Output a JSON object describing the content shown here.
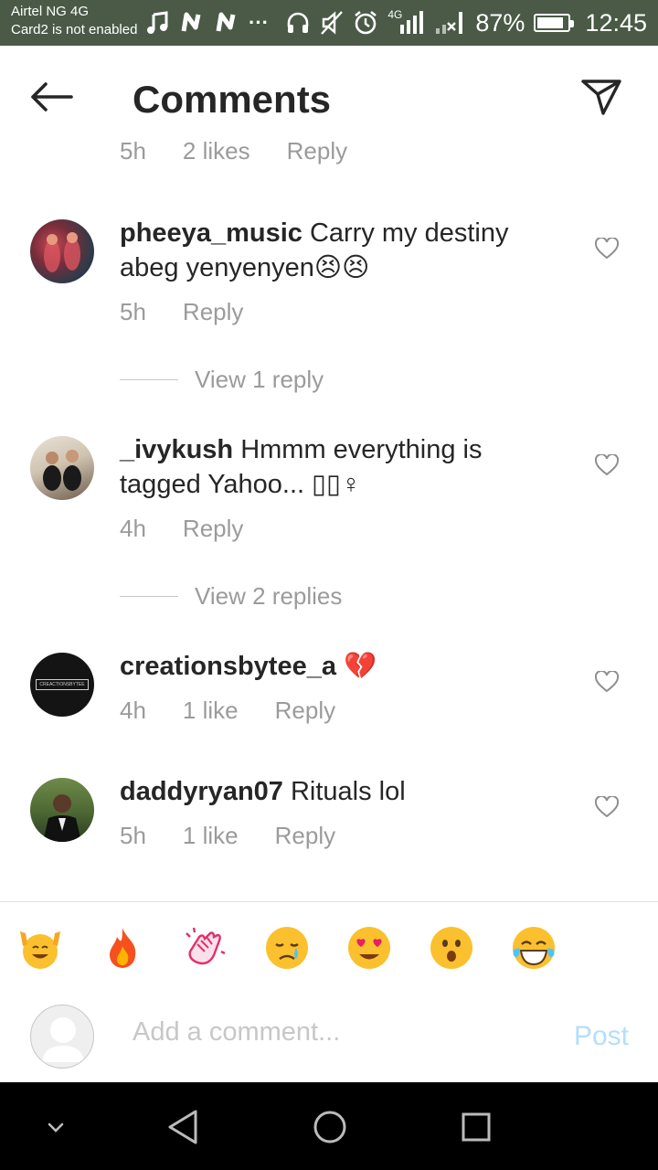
{
  "status_bar": {
    "carrier_line1": "Airtel NG 4G",
    "carrier_line2": "Card2 is not enabled",
    "notif_icons": [
      "music-note-icon",
      "n-app-icon",
      "n-app-icon",
      "more-dots-icon"
    ],
    "dots": "···",
    "network_type": "4G",
    "battery_percent": "87%",
    "battery_level": 0.87,
    "time": "12:45"
  },
  "header": {
    "title": "Comments"
  },
  "partial_comment": {
    "time": "5h",
    "likes": "2 likes",
    "reply": "Reply"
  },
  "comments": [
    {
      "username": "pheeya_music",
      "text": " Carry my destiny abeg yenyenyen",
      "emoji": "😣😣",
      "time": "5h",
      "likes": "",
      "reply": "Reply",
      "view_replies": "View 1 reply"
    },
    {
      "username": "_ivykush",
      "text": " Hmmm everything is tagged Yahoo... ",
      "emoji": "▯▯♀",
      "time": "4h",
      "likes": "",
      "reply": "Reply",
      "view_replies": "View 2 replies"
    },
    {
      "username": "creationsbytee_a",
      "text": " ",
      "emoji": "💔",
      "avatar_text": "CREACTIONSBYTEE",
      "time": "4h",
      "likes": "1 like",
      "reply": "Reply",
      "view_replies": ""
    },
    {
      "username": "daddyryan07",
      "text": " Rituals lol",
      "emoji": "",
      "time": "5h",
      "likes": "1 like",
      "reply": "Reply",
      "view_replies": ""
    }
  ],
  "emoji_bar": [
    "raising-hands-emoji",
    "fire-emoji",
    "clapping-hands-emoji",
    "crying-face-emoji",
    "heart-eyes-emoji",
    "surprised-face-emoji",
    "tears-of-joy-emoji"
  ],
  "composer": {
    "placeholder": "Add a comment...",
    "post_label": "Post"
  },
  "colors": {
    "status_bar_bg": "#4a5a47",
    "text_primary": "#262626",
    "text_secondary": "#9b9b9b",
    "post_disabled": "#b2dffc",
    "nav_bg": "#000000"
  }
}
